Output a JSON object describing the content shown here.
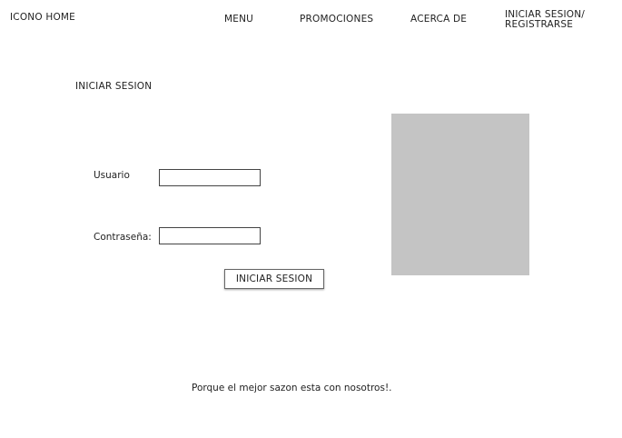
{
  "header": {
    "home_label": "ICONO HOME",
    "nav": {
      "menu": "MENU",
      "promotions": "PROMOCIONES",
      "about": "ACERCA DE",
      "login_line1": "INICIAR SESION/",
      "login_line2": "REGISTRARSE"
    }
  },
  "login": {
    "title": "INICIAR SESION",
    "username_label": "Usuario",
    "username_value": "",
    "password_label": "Contraseña:",
    "password_value": "",
    "submit_label": "INICIAR SESION"
  },
  "image_placeholder": {
    "color": "#c4c4c4"
  },
  "footer": {
    "tagline": "Porque el mejor sazon esta con nosotros!."
  }
}
